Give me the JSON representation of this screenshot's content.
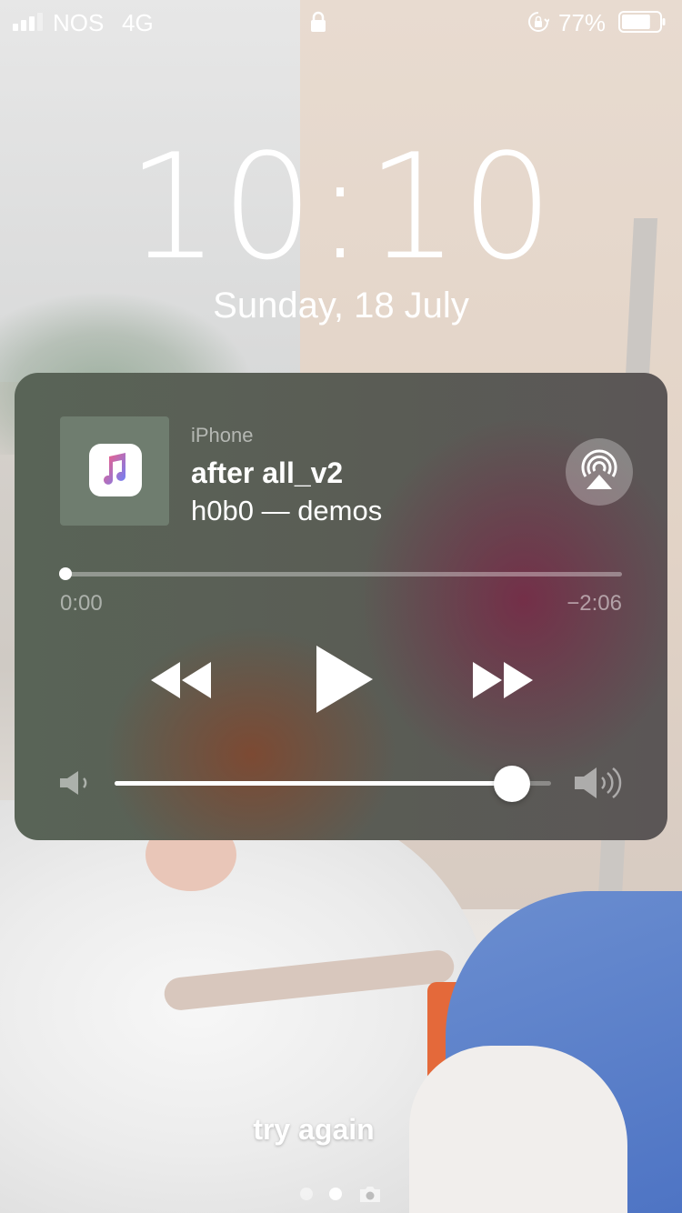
{
  "status_bar": {
    "carrier": "NOS",
    "network": "4G",
    "battery_percent": "77%",
    "battery_level": 0.77,
    "signal_bars_filled": 3,
    "signal_bars_total": 4
  },
  "lock_screen": {
    "time": "10:10",
    "date": "Sunday, 18 July"
  },
  "media": {
    "device": "iPhone",
    "title": "after all_v2",
    "subtitle": "h0b0 — demos",
    "elapsed": "0:00",
    "remaining": "−2:06",
    "progress": 0.0,
    "volume": 0.91
  },
  "caption": "try again",
  "pages": {
    "count": 2,
    "active_index": 1
  },
  "colors": {
    "music_gradient_top": "#fc5c7d",
    "music_gradient_bottom": "#6a82fb"
  }
}
